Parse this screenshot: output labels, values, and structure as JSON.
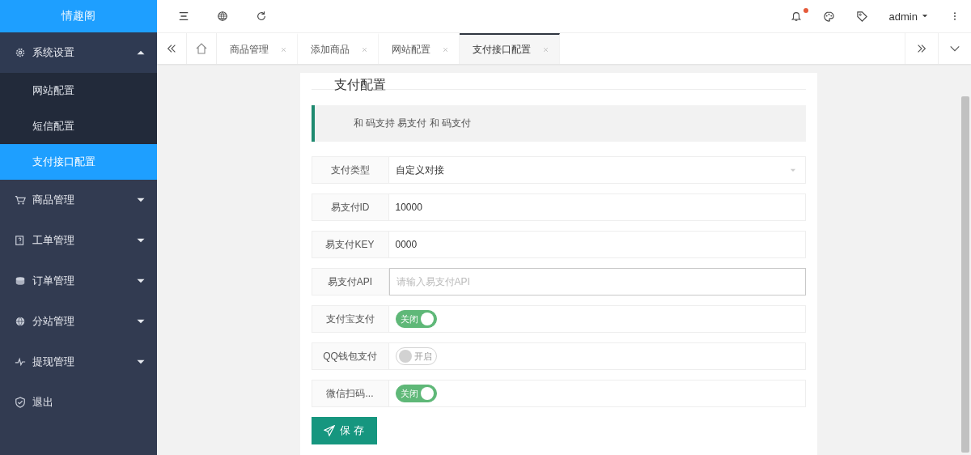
{
  "logo": {
    "title": "情趣阁"
  },
  "sidebar": {
    "items": [
      {
        "label": "系统设置",
        "expanded": true,
        "children": [
          {
            "label": "网站配置",
            "selected": false
          },
          {
            "label": "短信配置",
            "selected": false
          },
          {
            "label": "支付接口配置",
            "selected": true
          }
        ]
      },
      {
        "label": "商品管理",
        "expanded": false
      },
      {
        "label": "工单管理",
        "expanded": false
      },
      {
        "label": "订单管理",
        "expanded": false
      },
      {
        "label": "分站管理",
        "expanded": false
      },
      {
        "label": "提现管理",
        "expanded": false
      },
      {
        "label": "退出"
      }
    ]
  },
  "header": {
    "user": "admin",
    "notification": true
  },
  "tabs": [
    {
      "label": "商品管理",
      "selected": false
    },
    {
      "label": "添加商品",
      "selected": false
    },
    {
      "label": "网站配置",
      "selected": false
    },
    {
      "label": "支付接口配置",
      "selected": true
    }
  ],
  "card": {
    "title": "支付配置",
    "notice": "和 码支持 易支付 和 码支付",
    "fields": [
      {
        "kind": "select",
        "label": "支付类型",
        "value": "自定义对接"
      },
      {
        "kind": "input",
        "label": "易支付ID",
        "value": "10000"
      },
      {
        "kind": "input",
        "label": "易支付KEY",
        "value": "0000"
      },
      {
        "kind": "input",
        "label": "易支付API",
        "placeholder": "请输入易支付API",
        "focused": true
      },
      {
        "kind": "switch",
        "label": "支付宝支付",
        "on": true,
        "text": "关闭"
      },
      {
        "kind": "switch",
        "label": "QQ钱包支付",
        "on": false,
        "text": "开启"
      },
      {
        "kind": "switch",
        "label": "微信扫码...",
        "on": true,
        "text": "关闭"
      }
    ],
    "save": "保 存"
  }
}
